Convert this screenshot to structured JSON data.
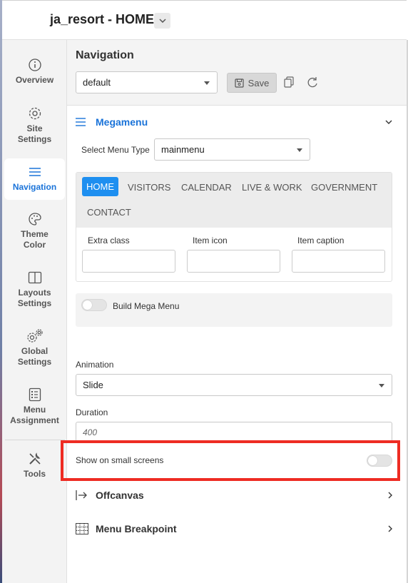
{
  "header": {
    "title": "ja_resort - HOME"
  },
  "sidebar": {
    "items": [
      {
        "label_line1": "Overview",
        "label_line2": "",
        "icon": "info-icon"
      },
      {
        "label_line1": "Site",
        "label_line2": "Settings",
        "icon": "gear-icon"
      },
      {
        "label_line1": "Navigation",
        "label_line2": "",
        "icon": "menu-icon",
        "active": true
      },
      {
        "label_line1": "Theme",
        "label_line2": "Color",
        "icon": "palette-icon"
      },
      {
        "label_line1": "Layouts",
        "label_line2": "Settings",
        "icon": "layout-icon"
      },
      {
        "label_line1": "Global",
        "label_line2": "Settings",
        "icon": "gears-icon"
      },
      {
        "label_line1": "Menu",
        "label_line2": "Assignment",
        "icon": "checklist-icon"
      },
      {
        "label_line1": "Tools",
        "label_line2": "",
        "icon": "tools-icon"
      }
    ]
  },
  "navigation": {
    "title": "Navigation",
    "preset_value": "default",
    "save_label": "Save"
  },
  "megamenu": {
    "title": "Megamenu",
    "select_menu_type_label": "Select Menu Type",
    "menu_type_value": "mainmenu",
    "tabs": [
      "HOME",
      "VISITORS",
      "CALENDAR",
      "LIVE & WORK",
      "GOVERNMENT",
      "CONTACT"
    ],
    "fields": [
      "Extra class",
      "Item icon",
      "Item caption"
    ],
    "build_mega_menu_label": "Build Mega Menu"
  },
  "animation": {
    "label": "Animation",
    "value": "Slide"
  },
  "duration": {
    "label": "Duration",
    "value": "400"
  },
  "small_screens": {
    "label": "Show on small screens"
  },
  "offcanvas": {
    "title": "Offcanvas"
  },
  "breakpoint": {
    "title": "Menu Breakpoint"
  },
  "colors": {
    "accent": "#1a73d9",
    "highlight": "#ee2c23"
  }
}
